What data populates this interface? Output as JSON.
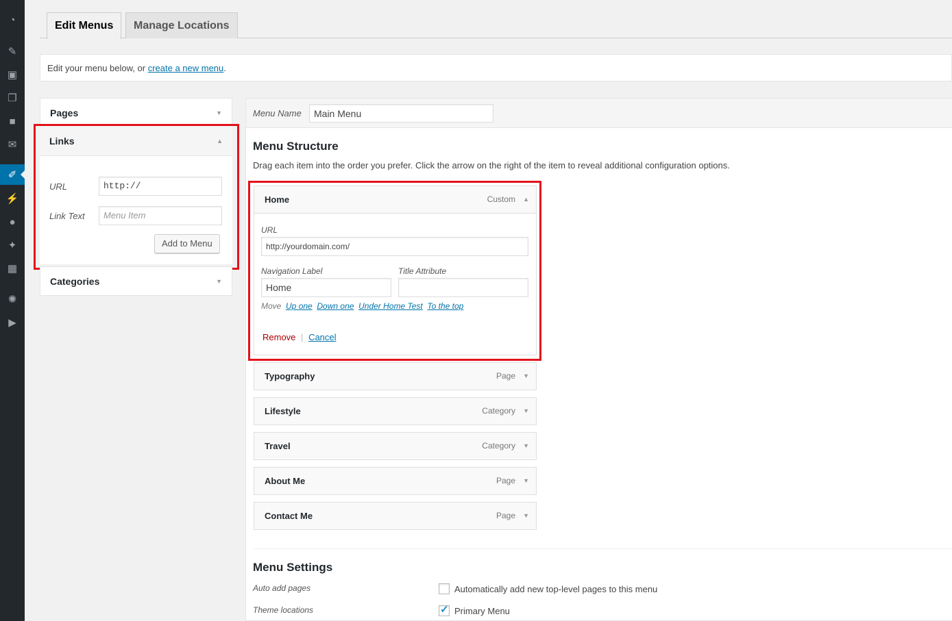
{
  "tabs": {
    "edit": "Edit Menus",
    "manage": "Manage Locations"
  },
  "notice": {
    "text": "Edit your menu below, or ",
    "link": "create a new menu",
    "end": "."
  },
  "left": {
    "pages": "Pages",
    "links": {
      "title": "Links",
      "url_label": "URL",
      "url_value": "http://",
      "text_label": "Link Text",
      "text_placeholder": "Menu Item",
      "button": "Add to Menu"
    },
    "categories": "Categories"
  },
  "menu": {
    "name_label": "Menu Name",
    "name_value": "Main Menu",
    "structure_title": "Menu Structure",
    "structure_desc": "Drag each item into the order you prefer. Click the arrow on the right of the item to reveal additional configuration options.",
    "home": {
      "title": "Home",
      "type": "Custom",
      "url_label": "URL",
      "url_value": "http://yourdomain.com/",
      "nav_label": "Navigation Label",
      "nav_value": "Home",
      "title_attr": "Title Attribute",
      "move": "Move",
      "up": "Up one",
      "down": "Down one",
      "under": "Under Home Test",
      "top": "To the top",
      "remove": "Remove",
      "sep": "|",
      "cancel": "Cancel"
    },
    "items": [
      {
        "title": "Typography",
        "type": "Page"
      },
      {
        "title": "Lifestyle",
        "type": "Category"
      },
      {
        "title": "Travel",
        "type": "Category"
      },
      {
        "title": "About Me",
        "type": "Page"
      },
      {
        "title": "Contact Me",
        "type": "Page"
      }
    ],
    "settings_title": "Menu Settings",
    "auto_add_label": "Auto add pages",
    "auto_add_text": "Automatically add new top-level pages to this menu",
    "auto_add_checked": false,
    "theme_label": "Theme locations",
    "primary_text": "Primary Menu",
    "primary_checked": true
  },
  "icons": [
    "dashboard-icon",
    "pin-icon",
    "media-icon",
    "pages-icon",
    "comments-icon",
    "mail-icon",
    "appearance-icon",
    "plugins-icon",
    "users-icon",
    "tools-icon",
    "settings-layout-icon",
    "settings-icon",
    "play-icon"
  ],
  "colors": {
    "highlight": "#e2121b",
    "accent": "#0073aa",
    "remove": "#a00"
  }
}
